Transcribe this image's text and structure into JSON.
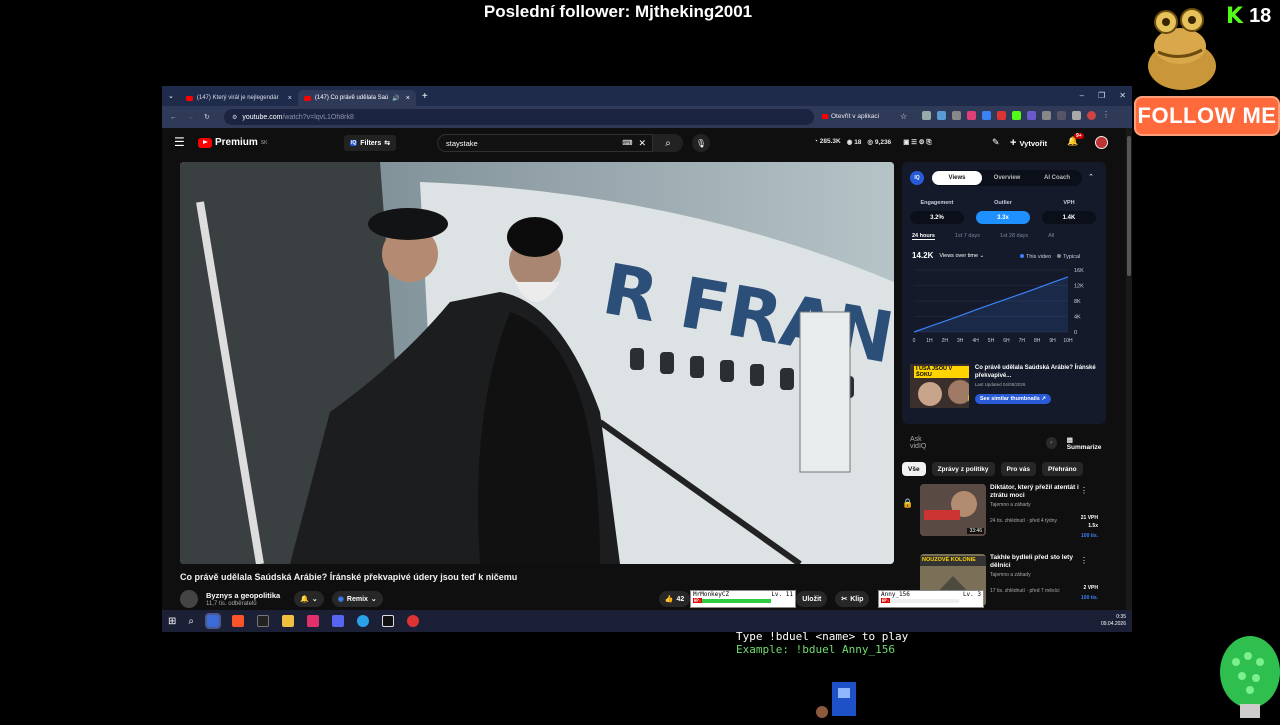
{
  "overlay": {
    "follower_text": "Poslední follower: Mjtheking2001",
    "kick_count": "18",
    "follow_label": "FOLLOW ME",
    "duel_line1": "Type !bduel <name> to play",
    "duel_line2": "Example: !bduel Anny_156"
  },
  "browser": {
    "tabs": [
      {
        "label": "(147) Který virál je nejlegendár"
      },
      {
        "label": "(147) Co právě udělala Saú"
      }
    ],
    "url_host": "youtube.com",
    "url_path": "/watch?v=lqvL1Oh8rk8",
    "open_in_app": "Otevřít v aplikaci"
  },
  "youtube": {
    "logo_text": "Premium",
    "logo_sup": "SK",
    "filters_label": "Filters",
    "search_value": "staystake",
    "stats": [
      "285.3K",
      "18",
      "9,236"
    ],
    "create_label": "Vytvořit",
    "notif_count": "9+",
    "video_title": "Co právě udělala Saúdská Arábie? Íránské překvapivé údery jsou teď k ničemu",
    "channel_name": "Byznys a geopolitika",
    "channel_subs": "11,7 tis. odběratelů",
    "remix_label": "Remix",
    "like_count": "42",
    "save_label": "Uložit",
    "clip_label": "Klip"
  },
  "vidiq": {
    "tabs": [
      "Views",
      "Overview",
      "AI Coach"
    ],
    "active_tab": "Views",
    "metrics": [
      {
        "label": "Engagement",
        "value": "3.2%"
      },
      {
        "label": "Outlier",
        "value": "3.3x"
      },
      {
        "label": "VPH",
        "value": "1.4K"
      }
    ],
    "periods": [
      "24 hours",
      "1st 7 days",
      "1st 28 days",
      "All"
    ],
    "views_total": "14.2K",
    "views_dropdown": "Views over time",
    "legend_this": "This video",
    "legend_typical": "Typical",
    "thumb_overlay": "I USA JSOU V ŠOKU",
    "thumb_title": "Co právě udělala Saúdská Arábie? Íránské překvapivé...",
    "last_updated": "Last Updated 04/08/2026",
    "similar_label": "See similar thumbnails",
    "ask_placeholder": "Ask vidIQ",
    "summarize_label": "Summarize"
  },
  "chart_data": {
    "type": "line",
    "x": [
      "0",
      "1H",
      "2H",
      "3H",
      "4H",
      "5H",
      "6H",
      "7H",
      "8H",
      "9H",
      "10H"
    ],
    "series": [
      {
        "name": "This video",
        "values": [
          0,
          1.4,
          2.8,
          4.2,
          5.7,
          7.1,
          8.5,
          9.9,
          11.3,
          12.8,
          14.2
        ]
      }
    ],
    "yticks": [
      "16K",
      "12K",
      "8K",
      "4K",
      "0"
    ],
    "ylim": [
      0,
      16
    ],
    "color": "#3b82f6"
  },
  "chips": [
    "Vše",
    "Zprávy z politiky",
    "Pro vás",
    "Přehráno"
  ],
  "recommendations": [
    {
      "title": "Diktátor, který přežil atentát i ztrátu moci",
      "channel": "Tajemno a záhady",
      "meta": "24 tis. zhlédnutí · před 4 týdny",
      "duration": "33:46",
      "vph": "21 VPH",
      "outlier": "1.5x",
      "extra": "100 tis."
    },
    {
      "title": "Takhle bydleli před sto lety dělníci",
      "channel": "Tajemno a záhady",
      "meta": "17 tis. zhlédnutí · před 7 měsíci",
      "duration": "",
      "vph": "2 VPH",
      "outlier": "",
      "extra": "100 tis.",
      "thumb_text": "NOUZOVÉ KOLONIE"
    }
  ],
  "game": {
    "p1_name": "MrMonkeyCZ",
    "p1_level": "Lv. 11",
    "p1_hp": "HP:",
    "p2_name": "Anny_156",
    "p2_level": "Lv. 3",
    "p2_hp": "HP:"
  },
  "taskbar": {
    "time": "0:35",
    "date": "09.04.2026"
  }
}
